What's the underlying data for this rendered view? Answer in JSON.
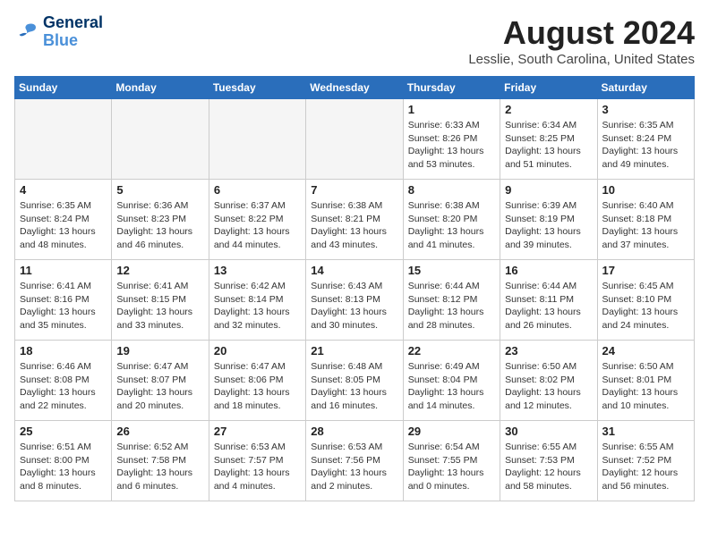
{
  "header": {
    "logo_line1": "General",
    "logo_line2": "Blue",
    "month_title": "August 2024",
    "location": "Lesslie, South Carolina, United States"
  },
  "weekdays": [
    "Sunday",
    "Monday",
    "Tuesday",
    "Wednesday",
    "Thursday",
    "Friday",
    "Saturday"
  ],
  "weeks": [
    [
      {
        "day": "",
        "info": ""
      },
      {
        "day": "",
        "info": ""
      },
      {
        "day": "",
        "info": ""
      },
      {
        "day": "",
        "info": ""
      },
      {
        "day": "1",
        "info": "Sunrise: 6:33 AM\nSunset: 8:26 PM\nDaylight: 13 hours\nand 53 minutes."
      },
      {
        "day": "2",
        "info": "Sunrise: 6:34 AM\nSunset: 8:25 PM\nDaylight: 13 hours\nand 51 minutes."
      },
      {
        "day": "3",
        "info": "Sunrise: 6:35 AM\nSunset: 8:24 PM\nDaylight: 13 hours\nand 49 minutes."
      }
    ],
    [
      {
        "day": "4",
        "info": "Sunrise: 6:35 AM\nSunset: 8:24 PM\nDaylight: 13 hours\nand 48 minutes."
      },
      {
        "day": "5",
        "info": "Sunrise: 6:36 AM\nSunset: 8:23 PM\nDaylight: 13 hours\nand 46 minutes."
      },
      {
        "day": "6",
        "info": "Sunrise: 6:37 AM\nSunset: 8:22 PM\nDaylight: 13 hours\nand 44 minutes."
      },
      {
        "day": "7",
        "info": "Sunrise: 6:38 AM\nSunset: 8:21 PM\nDaylight: 13 hours\nand 43 minutes."
      },
      {
        "day": "8",
        "info": "Sunrise: 6:38 AM\nSunset: 8:20 PM\nDaylight: 13 hours\nand 41 minutes."
      },
      {
        "day": "9",
        "info": "Sunrise: 6:39 AM\nSunset: 8:19 PM\nDaylight: 13 hours\nand 39 minutes."
      },
      {
        "day": "10",
        "info": "Sunrise: 6:40 AM\nSunset: 8:18 PM\nDaylight: 13 hours\nand 37 minutes."
      }
    ],
    [
      {
        "day": "11",
        "info": "Sunrise: 6:41 AM\nSunset: 8:16 PM\nDaylight: 13 hours\nand 35 minutes."
      },
      {
        "day": "12",
        "info": "Sunrise: 6:41 AM\nSunset: 8:15 PM\nDaylight: 13 hours\nand 33 minutes."
      },
      {
        "day": "13",
        "info": "Sunrise: 6:42 AM\nSunset: 8:14 PM\nDaylight: 13 hours\nand 32 minutes."
      },
      {
        "day": "14",
        "info": "Sunrise: 6:43 AM\nSunset: 8:13 PM\nDaylight: 13 hours\nand 30 minutes."
      },
      {
        "day": "15",
        "info": "Sunrise: 6:44 AM\nSunset: 8:12 PM\nDaylight: 13 hours\nand 28 minutes."
      },
      {
        "day": "16",
        "info": "Sunrise: 6:44 AM\nSunset: 8:11 PM\nDaylight: 13 hours\nand 26 minutes."
      },
      {
        "day": "17",
        "info": "Sunrise: 6:45 AM\nSunset: 8:10 PM\nDaylight: 13 hours\nand 24 minutes."
      }
    ],
    [
      {
        "day": "18",
        "info": "Sunrise: 6:46 AM\nSunset: 8:08 PM\nDaylight: 13 hours\nand 22 minutes."
      },
      {
        "day": "19",
        "info": "Sunrise: 6:47 AM\nSunset: 8:07 PM\nDaylight: 13 hours\nand 20 minutes."
      },
      {
        "day": "20",
        "info": "Sunrise: 6:47 AM\nSunset: 8:06 PM\nDaylight: 13 hours\nand 18 minutes."
      },
      {
        "day": "21",
        "info": "Sunrise: 6:48 AM\nSunset: 8:05 PM\nDaylight: 13 hours\nand 16 minutes."
      },
      {
        "day": "22",
        "info": "Sunrise: 6:49 AM\nSunset: 8:04 PM\nDaylight: 13 hours\nand 14 minutes."
      },
      {
        "day": "23",
        "info": "Sunrise: 6:50 AM\nSunset: 8:02 PM\nDaylight: 13 hours\nand 12 minutes."
      },
      {
        "day": "24",
        "info": "Sunrise: 6:50 AM\nSunset: 8:01 PM\nDaylight: 13 hours\nand 10 minutes."
      }
    ],
    [
      {
        "day": "25",
        "info": "Sunrise: 6:51 AM\nSunset: 8:00 PM\nDaylight: 13 hours\nand 8 minutes."
      },
      {
        "day": "26",
        "info": "Sunrise: 6:52 AM\nSunset: 7:58 PM\nDaylight: 13 hours\nand 6 minutes."
      },
      {
        "day": "27",
        "info": "Sunrise: 6:53 AM\nSunset: 7:57 PM\nDaylight: 13 hours\nand 4 minutes."
      },
      {
        "day": "28",
        "info": "Sunrise: 6:53 AM\nSunset: 7:56 PM\nDaylight: 13 hours\nand 2 minutes."
      },
      {
        "day": "29",
        "info": "Sunrise: 6:54 AM\nSunset: 7:55 PM\nDaylight: 13 hours\nand 0 minutes."
      },
      {
        "day": "30",
        "info": "Sunrise: 6:55 AM\nSunset: 7:53 PM\nDaylight: 12 hours\nand 58 minutes."
      },
      {
        "day": "31",
        "info": "Sunrise: 6:55 AM\nSunset: 7:52 PM\nDaylight: 12 hours\nand 56 minutes."
      }
    ]
  ]
}
